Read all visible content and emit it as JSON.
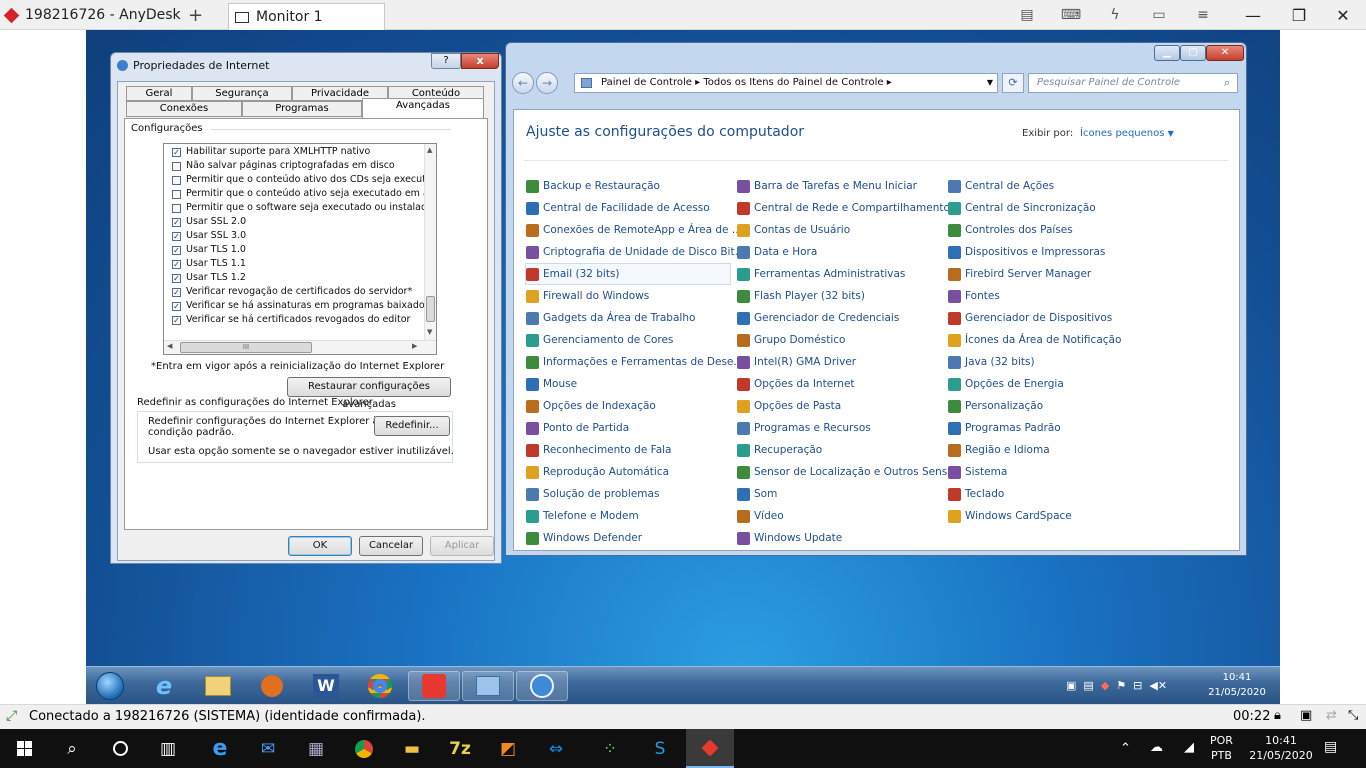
{
  "anydesk": {
    "tab_title": "198216726 - AnyDesk",
    "new_tab": "+",
    "monitor_label": "Monitor 1",
    "icons": [
      "chat-icon",
      "keyboard-icon",
      "action-icon",
      "display-icon",
      "menu-icon"
    ]
  },
  "dialog": {
    "title": "Propriedades de Internet",
    "help": "?",
    "close": "x",
    "tabs_row1": [
      "Geral",
      "Segurança",
      "Privacidade",
      "Conteúdo"
    ],
    "tabs_row2": [
      "Conexões",
      "Programas",
      "Avançadas"
    ],
    "section": "Configurações",
    "items": [
      {
        "label": "Habilitar suporte para XMLHTTP nativo",
        "checked": true
      },
      {
        "label": "Não salvar páginas criptografadas em disco",
        "checked": false
      },
      {
        "label": "Permitir que o conteúdo ativo dos CDs seja executado no",
        "checked": false
      },
      {
        "label": "Permitir que o conteúdo ativo seja executado em arquivos",
        "checked": false
      },
      {
        "label": "Permitir que o software seja executado ou instalado mesm",
        "checked": false
      },
      {
        "label": "Usar SSL 2.0",
        "checked": true
      },
      {
        "label": "Usar SSL 3.0",
        "checked": true
      },
      {
        "label": "Usar TLS 1.0",
        "checked": true
      },
      {
        "label": "Usar TLS 1.1",
        "checked": true
      },
      {
        "label": "Usar TLS 1.2",
        "checked": true
      },
      {
        "label": "Verificar revogação de certificados do servidor*",
        "checked": true
      },
      {
        "label": "Verificar se há assinaturas em programas baixados",
        "checked": true
      },
      {
        "label": "Verificar se há certificados revogados do editor",
        "checked": true
      }
    ],
    "scroll_mark": "III",
    "note": "*Entra em vigor após a reinicialização do Internet Explorer",
    "restore_btn": "Restaurar configurações avançadas",
    "reset_heading": "Redefinir as configurações do Internet Explorer",
    "reset_text_1": "Redefinir configurações do Internet Explorer à",
    "reset_text_2": "condição padrão.",
    "reset_btn": "Redefinir...",
    "reset_note": "Usar esta opção somente se o navegador estiver inutilizável.",
    "ok": "OK",
    "cancel": "Cancelar",
    "apply": "Aplicar"
  },
  "cp": {
    "breadcrumb_1": "Painel de Controle",
    "breadcrumb_2": "Todos os Itens do Painel de Controle",
    "search_placeholder": "Pesquisar Painel de Controle",
    "heading": "Ajuste as configurações do computador",
    "view_label": "Exibir por:",
    "view_value": "Ícones pequenos",
    "columns": [
      [
        "Backup e Restauração",
        "Central de Facilidade de Acesso",
        "Conexões de RemoteApp e Área de ...",
        "Criptografia de Unidade de Disco Bit...",
        "Email (32 bits)",
        "Firewall do Windows",
        "Gadgets da Área de Trabalho",
        "Gerenciamento de Cores",
        "Informações e Ferramentas de Dese...",
        "Mouse",
        "Opções de Indexação",
        "Ponto de Partida",
        "Reconhecimento de Fala",
        "Reprodução Automática",
        "Solução de problemas",
        "Telefone e Modem",
        "Windows Defender"
      ],
      [
        "Barra de Tarefas e Menu Iniciar",
        "Central de Rede e Compartilhamento",
        "Contas de Usuário",
        "Data e Hora",
        "Ferramentas Administrativas",
        "Flash Player (32 bits)",
        "Gerenciador de Credenciais",
        "Grupo Doméstico",
        "Intel(R) GMA Driver",
        "Opções da Internet",
        "Opções de Pasta",
        "Programas e Recursos",
        "Recuperação",
        "Sensor de Localização e Outros Sens...",
        "Som",
        "Vídeo",
        "Windows Update"
      ],
      [
        "Central de Ações",
        "Central de Sincronização",
        "Controles dos Países",
        "Dispositivos e Impressoras",
        "Firebird Server Manager",
        "Fontes",
        "Gerenciador de Dispositivos",
        "Ícones da Área de Notificação",
        "Java (32 bits)",
        "Opções de Energia",
        "Personalização",
        "Programas Padrão",
        "Região e Idioma",
        "Sistema",
        "Teclado",
        "Windows CardSpace"
      ]
    ],
    "icon_colors": [
      "#3d8b3d",
      "#2e6fb6",
      "#b86c1c",
      "#7a4fa0",
      "#c0392b",
      "#e0a020",
      "#4a7ab0",
      "#2a9d8f"
    ]
  },
  "remote_taskbar": {
    "clock_time": "10:41",
    "clock_date": "21/05/2020",
    "apps": [
      "start-orb",
      "internet-explorer-icon",
      "explorer-icon",
      "media-player-icon",
      "word-icon",
      "chrome-icon",
      "anydesk-icon",
      "control-panel-icon",
      "internet-options-icon"
    ]
  },
  "status": {
    "text": "Conectado a 198216726 (SISTEMA) (identidade confirmada).",
    "timer": "00:22"
  },
  "win_taskbar": {
    "lang_1": "POR",
    "lang_2": "PTB",
    "time": "10:41",
    "date": "21/05/2020"
  }
}
